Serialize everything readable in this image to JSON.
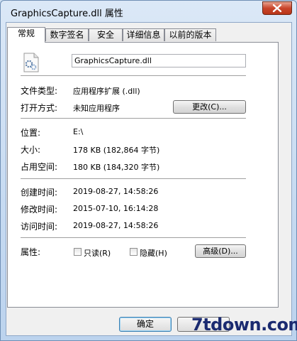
{
  "window": {
    "title": "GraphicsCapture.dll 属性"
  },
  "tabs": [
    {
      "label": "常规",
      "active": true
    },
    {
      "label": "数字签名",
      "active": false
    },
    {
      "label": "安全",
      "active": false
    },
    {
      "label": "详细信息",
      "active": false
    },
    {
      "label": "以前的版本",
      "active": false
    }
  ],
  "file": {
    "name": "GraphicsCapture.dll",
    "icon": "dll-file-icon"
  },
  "type": {
    "label": "文件类型:",
    "value": "应用程序扩展 (.dll)"
  },
  "opens_with": {
    "label": "打开方式:",
    "value": "未知应用程序",
    "change_button": "更改(C)..."
  },
  "location": {
    "label": "位置:",
    "value": "E:\\"
  },
  "size": {
    "label": "大小:",
    "value": "178 KB (182,864 字节)"
  },
  "size_on_disk": {
    "label": "占用空间:",
    "value": "180 KB (184,320 字节)"
  },
  "created": {
    "label": "创建时间:",
    "value": "2019-08-27, 14:58:26"
  },
  "modified": {
    "label": "修改时间:",
    "value": "2015-07-10, 16:14:28"
  },
  "accessed": {
    "label": "访问时间:",
    "value": "2019-08-27, 14:58:26"
  },
  "attributes": {
    "label": "属性:",
    "readonly_label": "只读(R)",
    "hidden_label": "隐藏(H)",
    "advanced_button": "高级(D)..."
  },
  "footer": {
    "ok_button": "确定",
    "cancel_button": ""
  },
  "watermark": "7tdown.com"
}
